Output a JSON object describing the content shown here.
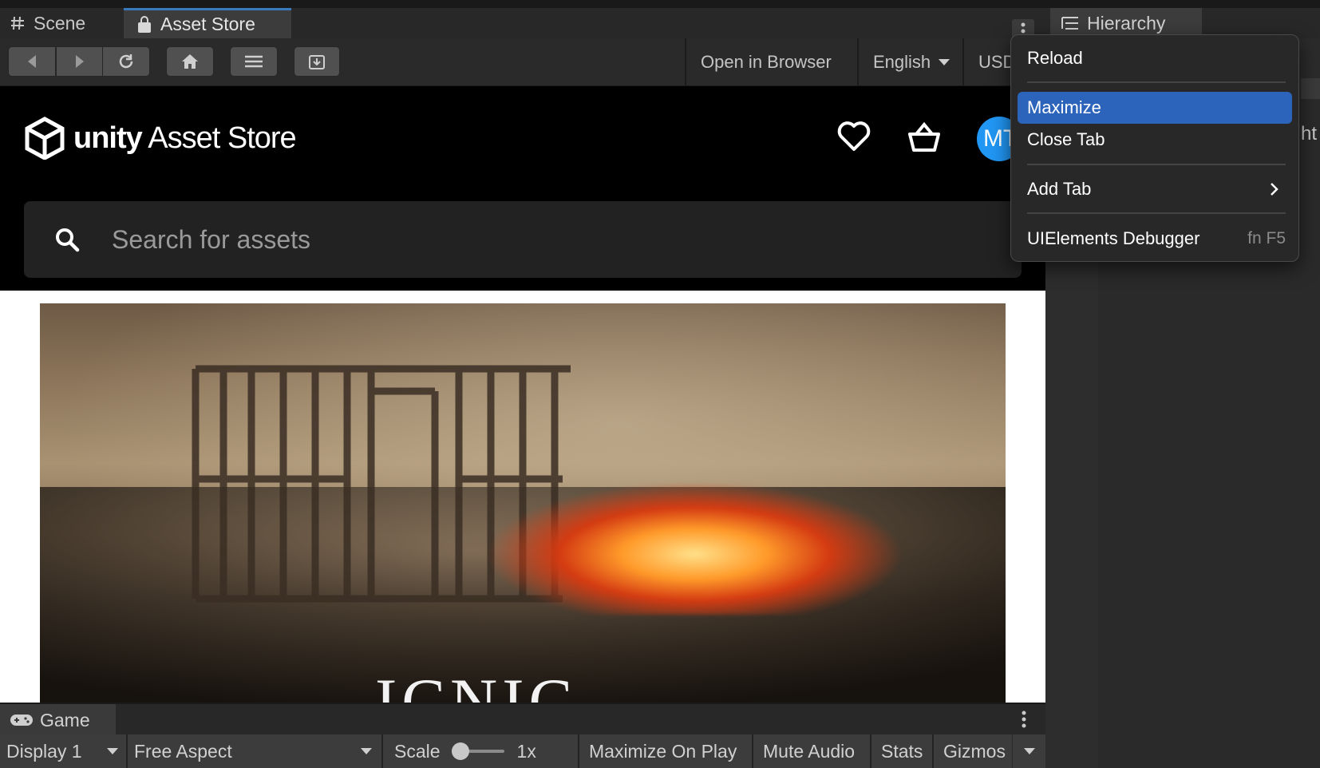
{
  "tabs": {
    "scene_label": "Scene",
    "asset_store_label": "Asset Store",
    "hierarchy_label": "Hierarchy",
    "game_label": "Game"
  },
  "toolbar": {
    "open_in_browser": "Open in Browser",
    "language": "English",
    "currency": "USD"
  },
  "store": {
    "logo_brand": "unity",
    "logo_product": "Asset Store",
    "avatar_initials": "MT",
    "search_placeholder": "Search for assets",
    "hero_caption": "ICNIC"
  },
  "context_menu": {
    "items": [
      {
        "label": "Reload"
      },
      {
        "label": "Maximize",
        "highlighted": true
      },
      {
        "label": "Close Tab"
      },
      {
        "label": "Add Tab",
        "has_submenu": true
      },
      {
        "label": "UIElements Debugger",
        "shortcut": "fn F5"
      }
    ]
  },
  "right_panel": {
    "partial_text": "ht"
  },
  "game_toolbar": {
    "display": "Display 1",
    "aspect": "Free Aspect",
    "scale_label": "Scale",
    "scale_value": "1x",
    "maximize_on_play": "Maximize On Play",
    "mute_audio": "Mute Audio",
    "stats": "Stats",
    "gizmos": "Gizmos"
  },
  "colors": {
    "accent_tab": "#3a79bb",
    "menu_highlight": "#2c64bb",
    "avatar": "#2196f3"
  },
  "icons": [
    "hash-icon",
    "lock-bag-icon",
    "kebab-menu-icon",
    "list-tree-icon",
    "back-icon",
    "forward-icon",
    "reload-icon",
    "home-icon",
    "list-icon",
    "download-icon",
    "unity-logo-icon",
    "heart-icon",
    "basket-icon",
    "search-icon",
    "gamepad-icon",
    "chevron-right-icon"
  ]
}
